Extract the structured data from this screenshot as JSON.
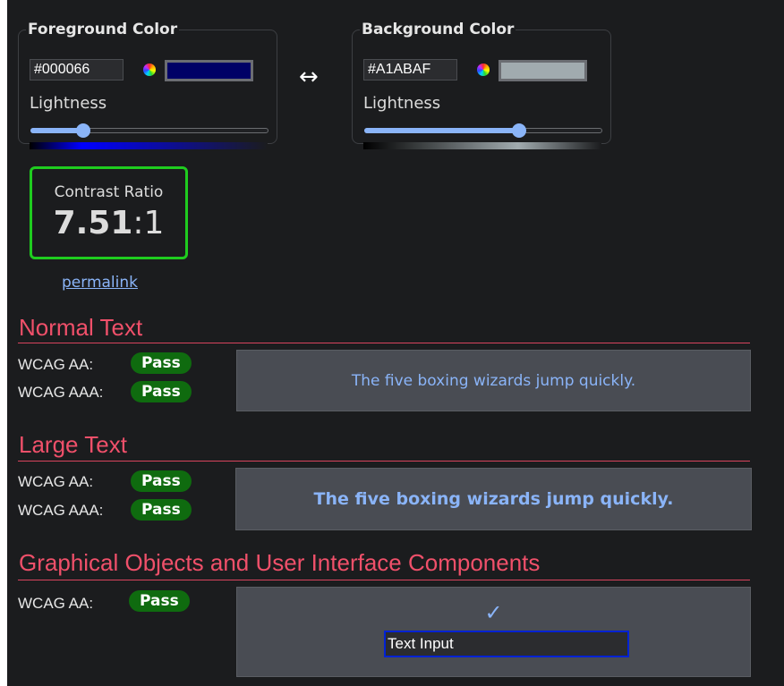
{
  "foreground": {
    "legend": "Foreground Color",
    "hex": "#000066",
    "color_wheel_icon": "color-wheel-icon",
    "swatch_color": "#000066",
    "lightness_label": "Lightness",
    "lightness_level": 0.22,
    "gradient": [
      "#000000",
      "#0000ff",
      "#1b1c1e"
    ]
  },
  "swap_icon": "↔",
  "background": {
    "legend": "Background Color",
    "hex": "#A1ABAF",
    "color_wheel_icon": "color-wheel-icon",
    "swatch_color": "#A1ABAF",
    "lightness_label": "Lightness",
    "lightness_level": 0.65,
    "gradient": [
      "#000000",
      "#a1abaf",
      "#1b1c1e"
    ]
  },
  "contrast": {
    "label": "Contrast Ratio",
    "value": "7.51",
    "suffix": ":1",
    "border_color": "#1fcc1f"
  },
  "permalink": "permalink",
  "sections": {
    "normal": {
      "title": "Normal Text",
      "aa_label": "WCAG AA:",
      "aa_result": "Pass",
      "aaa_label": "WCAG AAA:",
      "aaa_result": "Pass",
      "sample": "The five boxing wizards jump quickly."
    },
    "large": {
      "title": "Large Text",
      "aa_label": "WCAG AA:",
      "aa_result": "Pass",
      "aaa_label": "WCAG AAA:",
      "aaa_result": "Pass",
      "sample": "The five boxing wizards jump quickly."
    },
    "graphics": {
      "title": "Graphical Objects and User Interface Components",
      "aa_label": "WCAG AA:",
      "aa_result": "Pass",
      "check_icon": "✓",
      "input_value": "Text Input"
    }
  },
  "colors": {
    "accent": "#8ab4f8",
    "heading": "#f0506a",
    "pass_badge": "#0f6b0f"
  }
}
